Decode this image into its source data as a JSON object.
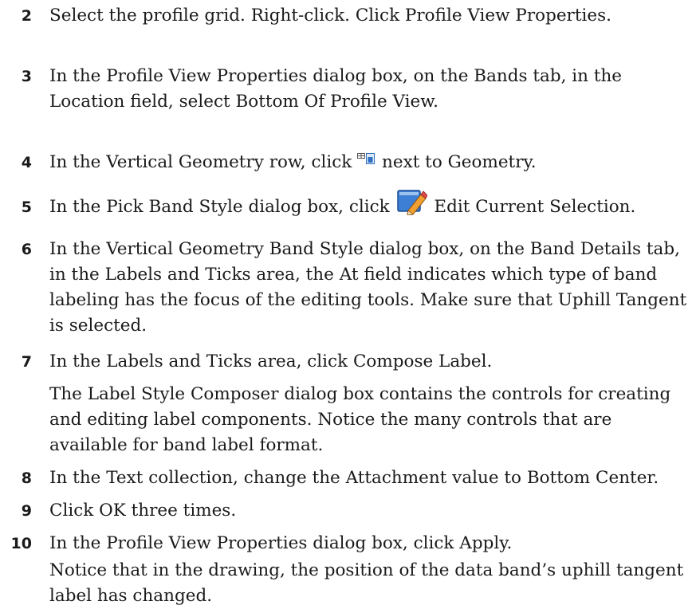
{
  "steps": [
    {
      "num": "2",
      "text": "Select the profile grid. Right-click. Click Profile View Properties."
    },
    {
      "num": "3",
      "text": "In the Profile View Properties dialog box, on the Bands tab, in the Location field, select Bottom Of Profile View."
    },
    {
      "num": "4",
      "before": "In the Vertical Geometry row, click",
      "after": "next to Geometry.",
      "icon": "band-grid-icon"
    },
    {
      "num": "5",
      "before": "In the Pick Band Style dialog box, click",
      "after": "Edit Current Selection.",
      "icon": "edit-pencil-icon"
    },
    {
      "num": "6",
      "text": "In the Vertical Geometry Band Style dialog box, on the Band Details tab, in the Labels and Ticks area, the At field indicates which type of band labeling has the focus of the editing tools. Make sure that Uphill Tangent is selected."
    },
    {
      "num": "7",
      "text": "In the Labels and Ticks area, click Compose Label.",
      "note": "The Label Style Composer dialog box contains the controls for creating and editing label components. Notice the many controls that are available for band label format."
    },
    {
      "num": "8",
      "text": "In the Text collection, change the Attachment value to Bottom Center."
    },
    {
      "num": "9",
      "text": "Click OK three times."
    },
    {
      "num": "10",
      "text": "In the Profile View Properties dialog box, click Apply.",
      "note": "Notice that in the drawing, the position of the data band’s uphill tangent label has changed."
    }
  ],
  "colors": {
    "text": "#1a1a1a",
    "icon_blue": "#2f6fc1",
    "icon_orange": "#f0a030"
  }
}
